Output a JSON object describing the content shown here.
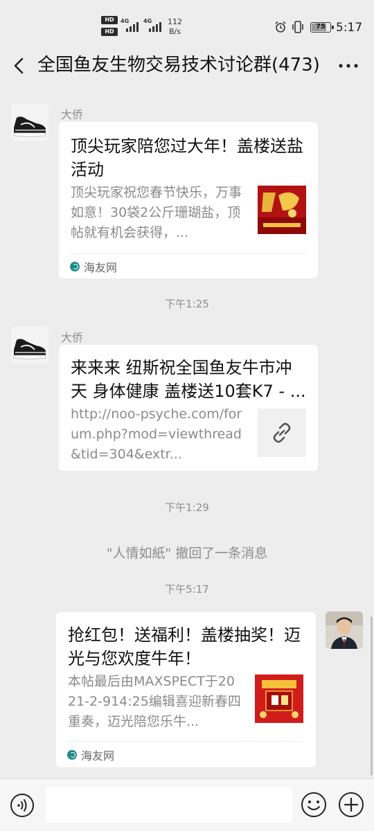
{
  "status_bar": {
    "hd1": "HD",
    "hd2": "HD",
    "net1": "4G",
    "net2": "4G",
    "speed_value": "112",
    "speed_unit": "B/s",
    "battery": "75",
    "time": "5:17"
  },
  "header": {
    "title": "全国鱼友生物交易技术讨论群(473)"
  },
  "messages": [
    {
      "sender": "大侨",
      "title": "顶尖玩家陪您过大年！盖楼送盐活动",
      "description": "顶尖玩家祝您春节快乐，万事如意！30袋2公斤珊瑚盐，顶帖就有机会获得，...",
      "source": "海友网"
    },
    {
      "time": "下午1:25"
    },
    {
      "sender": "大侨",
      "title": "来来来 纽斯祝全国鱼友牛市冲天 身体健康 盖楼送10套K7 - ...",
      "description": "http://noo-psyche.com/forum.php?mod=viewthread&tid=304&extr..."
    },
    {
      "time": "下午1:29"
    },
    {
      "notice": "\"人情如紙\" 撤回了一条消息"
    },
    {
      "time": "下午5:17"
    },
    {
      "title": "抢红包！送福利！盖楼抽奖！迈光与您欢度牛年！",
      "description": "本帖最后由MAXSPECT于2021-2-914:25编辑喜迎新春四重奏，迈光陪您乐牛...",
      "source": "海友网"
    }
  ],
  "input": {
    "placeholder": ""
  },
  "colors": {
    "background": "#ededed",
    "card": "#ffffff",
    "muted_text": "#8d8d8d"
  }
}
